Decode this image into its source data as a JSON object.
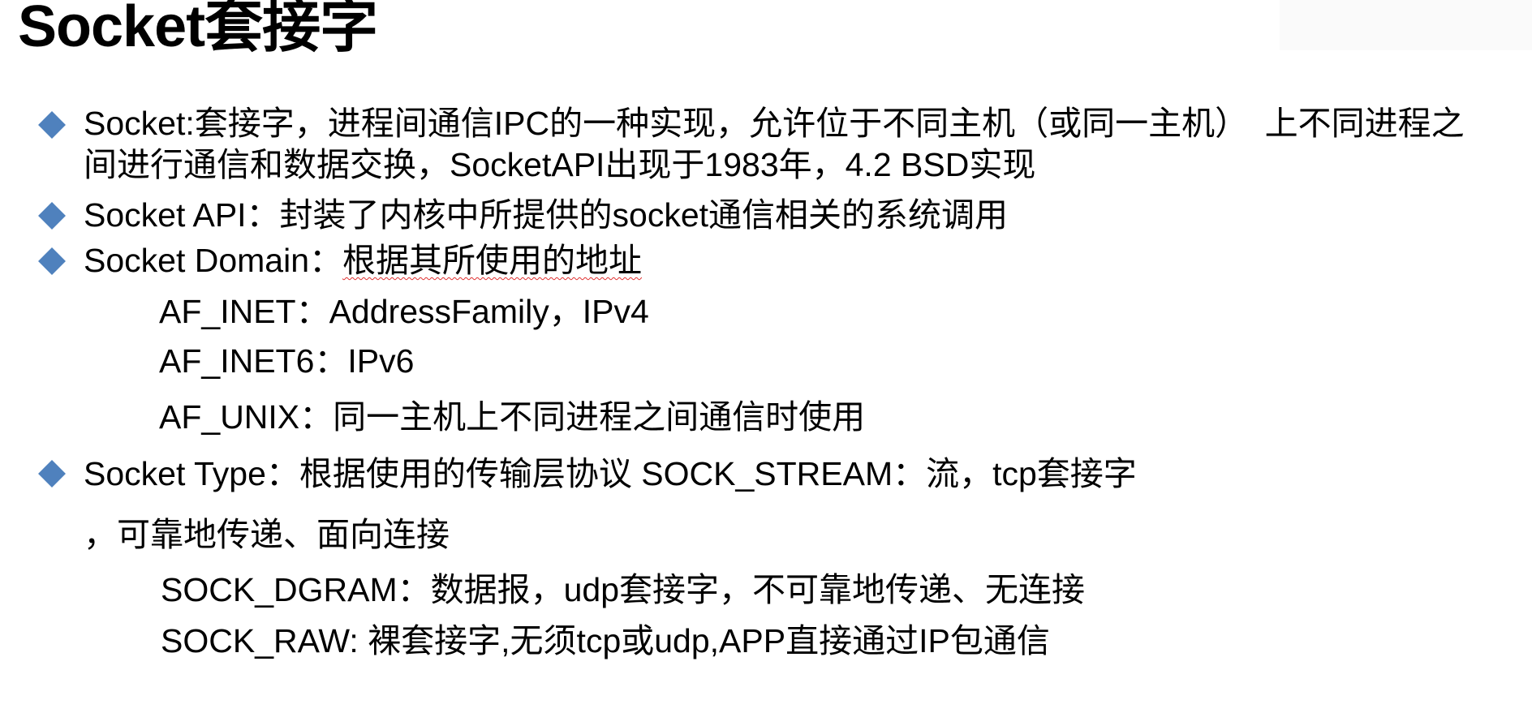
{
  "title": "Socket套接字",
  "bullets": {
    "socket": {
      "line1": "Socket:套接字，进程间通信IPC的一种实现，允许位于不同主机（或同一主机）　上不同进程之",
      "line2": "间进行通信和数据交换，SocketAPI出现于1983年，4.2 BSD实现"
    },
    "api": "Socket API：封装了内核中所提供的socket通信相关的系统调用",
    "domain": {
      "prefix": "Socket Domain：",
      "suffix": "根据其所使用的地址",
      "items": [
        "AF_INET：AddressFamily，IPv4",
        "AF_INET6：IPv6",
        "AF_UNIX：同一主机上不同进程之间通信时使用"
      ]
    },
    "type": {
      "line1": "Socket Type：根据使用的传输层协议 SOCK_STREAM：流，tcp套接字",
      "line2": "，可靠地传递、面向连接",
      "items": [
        "SOCK_DGRAM：数据报，udp套接字，不可靠地传递、无连接",
        "SOCK_RAW: 裸套接字,无须tcp或udp,APP直接通过IP包通信"
      ]
    }
  },
  "colors": {
    "bullet": "#4f81bd",
    "text": "#000000",
    "spellcheck_underline": "#e03030"
  }
}
